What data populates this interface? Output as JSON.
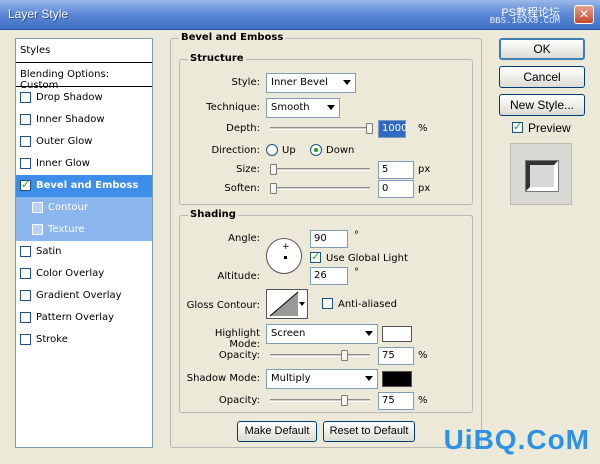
{
  "window": {
    "title": "Layer Style",
    "close_glyph": "✕",
    "watermark_top": "PS教程论坛",
    "watermark_url": "BBS.16XX8.COM"
  },
  "styles_panel": {
    "header": "Styles",
    "blending": "Blending Options: Custom",
    "items": [
      {
        "label": "Drop Shadow",
        "checked": false
      },
      {
        "label": "Inner Shadow",
        "checked": false
      },
      {
        "label": "Outer Glow",
        "checked": false
      },
      {
        "label": "Inner Glow",
        "checked": false
      },
      {
        "label": "Bevel and Emboss",
        "checked": true
      },
      {
        "label": "Contour",
        "checked": false
      },
      {
        "label": "Texture",
        "checked": false
      },
      {
        "label": "Satin",
        "checked": false
      },
      {
        "label": "Color Overlay",
        "checked": false
      },
      {
        "label": "Gradient Overlay",
        "checked": false
      },
      {
        "label": "Pattern Overlay",
        "checked": false
      },
      {
        "label": "Stroke",
        "checked": false
      }
    ]
  },
  "bevel": {
    "title": "Bevel and Emboss",
    "structure": {
      "title": "Structure",
      "style_label": "Style:",
      "style_value": "Inner Bevel",
      "technique_label": "Technique:",
      "technique_value": "Smooth",
      "depth_label": "Depth:",
      "depth_value": "1000",
      "depth_unit": "%",
      "direction_label": "Direction:",
      "dir_up": "Up",
      "dir_down": "Down",
      "size_label": "Size:",
      "size_value": "5",
      "size_unit": "px",
      "soften_label": "Soften:",
      "soften_value": "0",
      "soften_unit": "px"
    },
    "shading": {
      "title": "Shading",
      "angle_label": "Angle:",
      "angle_value": "90",
      "angle_unit": "°",
      "global_light": "Use Global Light",
      "altitude_label": "Altitude:",
      "altitude_value": "26",
      "altitude_unit": "°",
      "gloss_label": "Gloss Contour:",
      "anti_aliased": "Anti-aliased",
      "highlight_label": "Highlight Mode:",
      "highlight_value": "Screen",
      "highlight_color": "#ffffff",
      "hl_opacity_label": "Opacity:",
      "hl_opacity_value": "75",
      "hl_opacity_unit": "%",
      "shadow_label": "Shadow Mode:",
      "shadow_value": "Multiply",
      "shadow_color": "#000000",
      "sh_opacity_label": "Opacity:",
      "sh_opacity_value": "75",
      "sh_opacity_unit": "%"
    },
    "make_default": "Make Default",
    "reset_default": "Reset to Default"
  },
  "right": {
    "ok": "OK",
    "cancel": "Cancel",
    "new_style": "New Style...",
    "preview": "Preview"
  },
  "logo": "UiBQ.CoM"
}
